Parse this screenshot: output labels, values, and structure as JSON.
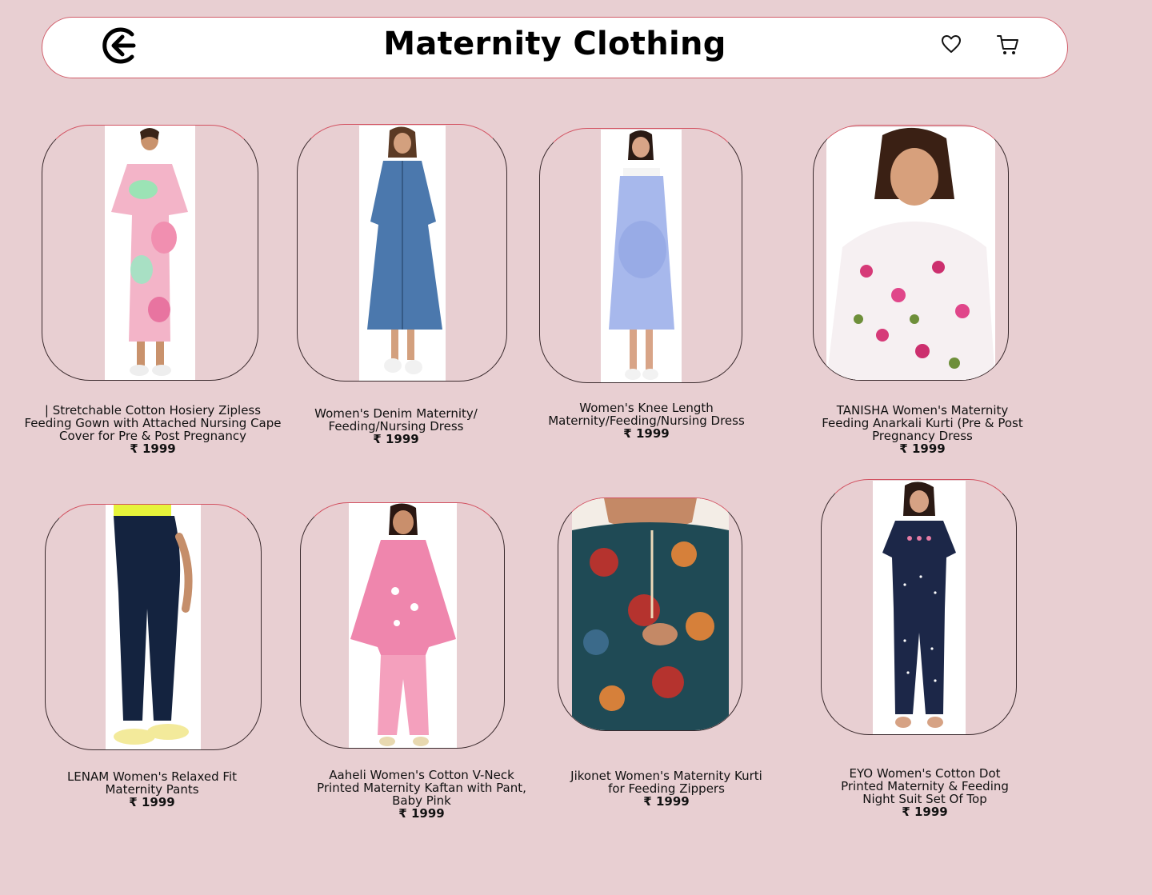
{
  "header": {
    "title": "Maternity Clothing",
    "back_icon": "arrow-left-circle-icon",
    "wishlist_icon": "heart-icon",
    "cart_icon": "cart-icon",
    "border_color": "#d05a67"
  },
  "theme": {
    "background": "#e8cfd2",
    "card_border": "#3a2a2d",
    "card_border_accent": "#d25261"
  },
  "products": [
    {
      "name": "| Stretchable Cotton Hosiery Zipless Feeding Gown with Attached Nursing Cape Cover for Pre & Post Pregnancy",
      "price": "₹ 1999"
    },
    {
      "name": "Women's Denim Maternity/ Feeding/Nursing Dress",
      "price": "₹ 1999"
    },
    {
      "name": "Women's Knee Length Maternity/Feeding/Nursing Dress",
      "price": "₹ 1999"
    },
    {
      "name": "TANISHA Women's Maternity Feeding Anarkali Kurti (Pre & Post Pregnancy Dress",
      "price": "₹ 1999"
    },
    {
      "name": "LENAM Women's Relaxed Fit Maternity Pants",
      "price": "₹ 1999"
    },
    {
      "name": "Aaheli Women's Cotton V-Neck Printed Maternity Kaftan with Pant, Baby Pink",
      "price": "₹ 1999"
    },
    {
      "name": "Jikonet Women's Maternity Kurti for Feeding Zippers",
      "price": "₹ 1999"
    },
    {
      "name": "EYO Women's Cotton Dot Printed Maternity & Feeding Night Suit Set Of Top",
      "price": "₹ 1999"
    }
  ]
}
